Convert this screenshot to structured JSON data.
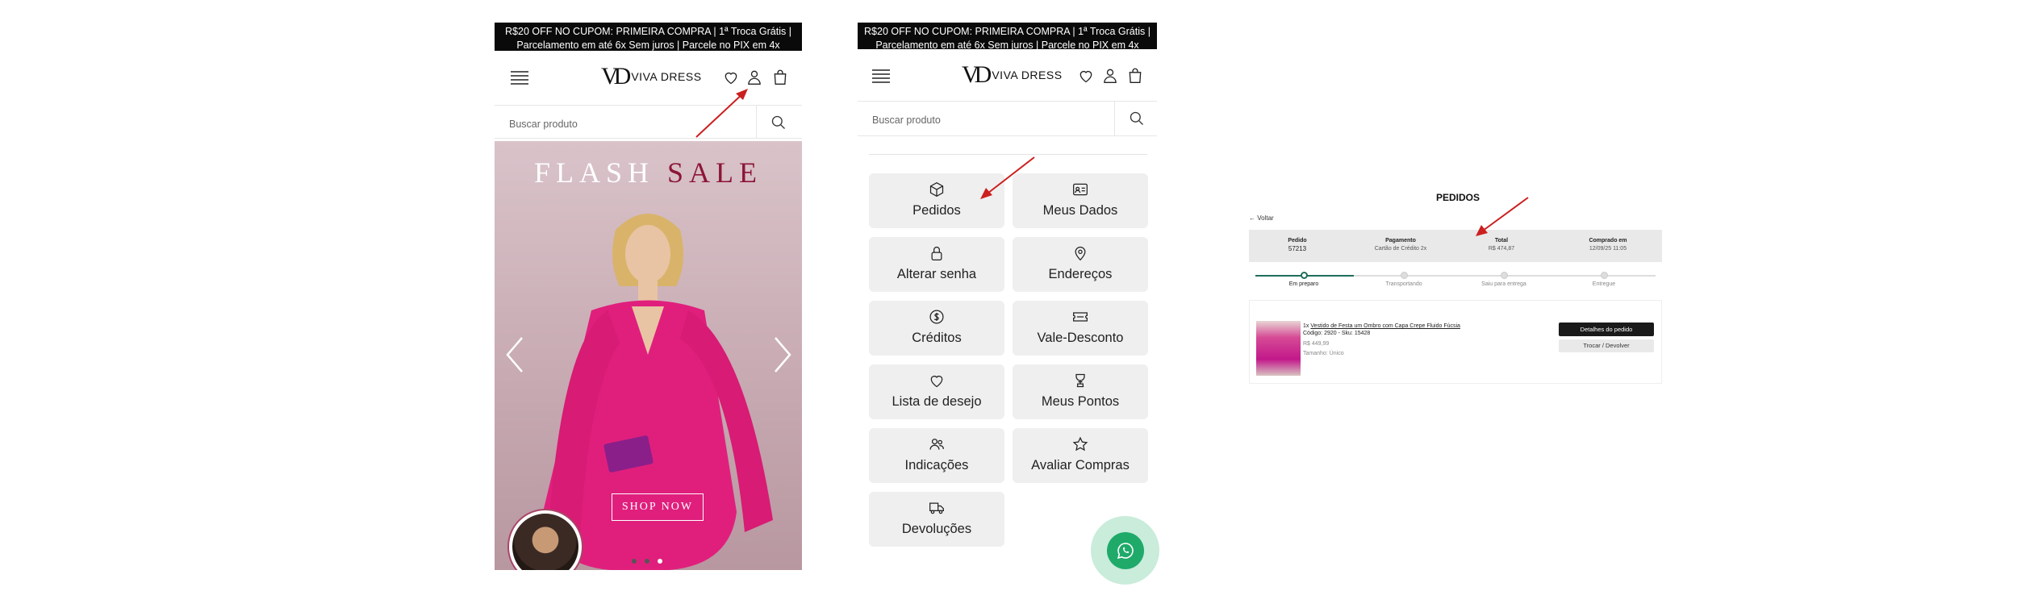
{
  "promo_line1": "R$20 OFF NO CUPOM: PRIMEIRA COMPRA | 1ª Troca Grátis |",
  "promo_line2": "Parcelamento em até 6x Sem juros | Parcele no PIX em 4x",
  "brand": {
    "mark": "VD",
    "name": "VIVA DRESS"
  },
  "search": {
    "placeholder": "Buscar produto"
  },
  "hero": {
    "flash": "FLASH",
    "sale": "SALE",
    "cta": "SHOP NOW",
    "slide_index": 3,
    "slide_count": 3
  },
  "account_menu": [
    {
      "label": "Pedidos",
      "icon": "box-icon"
    },
    {
      "label": "Meus Dados",
      "icon": "id-card-icon"
    },
    {
      "label": "Alterar senha",
      "icon": "lock-icon"
    },
    {
      "label": "Endereços",
      "icon": "map-pin-icon"
    },
    {
      "label": "Créditos",
      "icon": "dollar-coin-icon"
    },
    {
      "label": "Vale-Desconto",
      "icon": "ticket-icon"
    },
    {
      "label": "Lista de desejo",
      "icon": "heart-icon"
    },
    {
      "label": "Meus Pontos",
      "icon": "trophy-icon"
    },
    {
      "label": "Indicações",
      "icon": "users-icon"
    },
    {
      "label": "Avaliar Compras",
      "icon": "star-icon"
    },
    {
      "label": "Devoluções",
      "icon": "truck-icon"
    }
  ],
  "orders": {
    "title": "PEDIDOS",
    "back": "← Voltar",
    "header": [
      {
        "key": "Pedido",
        "value": "57213"
      },
      {
        "key": "Pagamento",
        "value": "Cartão de Crédito 2x"
      },
      {
        "key": "Total",
        "value": "R$ 474,87"
      },
      {
        "key": "Comprado em",
        "value": "12/09/25 11:05"
      }
    ],
    "steps": [
      "Em preparo",
      "Transportando",
      "Saiu para entrega",
      "Entregue"
    ],
    "active_step": 1,
    "item": {
      "qty": "1x",
      "name": "Vestido de Festa um Ombro com Capa Crepe Fluido Fúcsia",
      "code": "Código: 2920 - Sku: 15428",
      "price": "R$ 449,99",
      "size": "Tamanho: Único"
    },
    "details_button": "Detalhes do pedido",
    "exchange_button": "Trocar / Devolver"
  },
  "colors": {
    "accent_red": "#cc1f1f",
    "whatsapp": "#1faa6a",
    "progress": "#1f6e5a",
    "sale": "#8c1538"
  }
}
